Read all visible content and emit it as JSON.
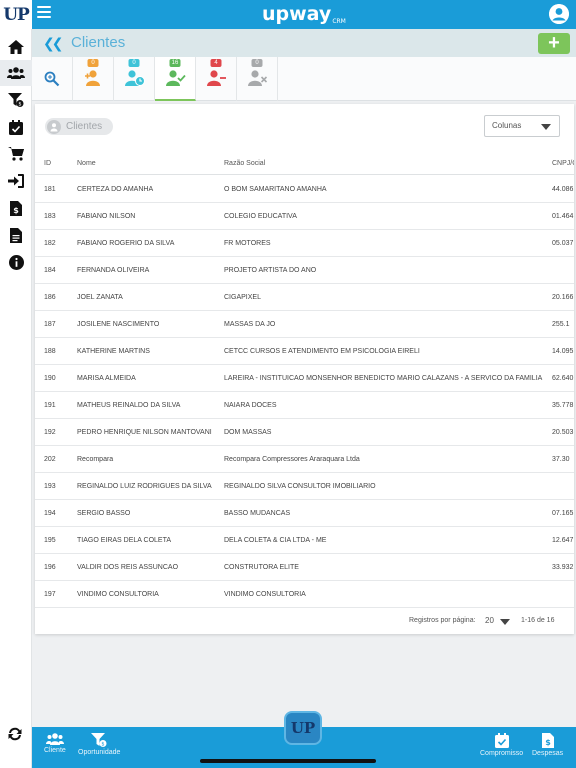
{
  "app": {
    "logo_text": "UP",
    "brand": "upway",
    "brand_suffix": "CRM",
    "center_logo_text": "UP"
  },
  "header": {
    "title": "Clientes",
    "add_label": "+"
  },
  "tabs": [
    {
      "badge": "0",
      "badge_color": "#f0a23a",
      "icon": "add-user-icon",
      "icon_color": "#f0a23a"
    },
    {
      "badge": "0",
      "badge_color": "#3ec3d8",
      "icon": "user-clock-icon",
      "icon_color": "#3ec3d8"
    },
    {
      "badge": "16",
      "badge_color": "#5cb85c",
      "icon": "user-check-icon",
      "icon_color": "#5cb85c"
    },
    {
      "badge": "4",
      "badge_color": "#e0474c",
      "icon": "remove-user-icon",
      "icon_color": "#e0474c"
    },
    {
      "badge": "0",
      "badge_color": "#a7a9ab",
      "icon": "user-x-icon",
      "icon_color": "#a7a9ab"
    }
  ],
  "filter_chip": "Clientes",
  "columns_select": "Colunas",
  "table": {
    "headers": {
      "id": "ID",
      "nome": "Nome",
      "razao": "Razão Social",
      "cnpj": "CNPJ/C"
    },
    "rows": [
      {
        "id": "181",
        "nome": "CERTEZA DO AMANHA",
        "razao": "O BOM SAMARITANO AMANHA",
        "cnpj": "44.086"
      },
      {
        "id": "183",
        "nome": "FABIANO NILSON",
        "razao": "COLEGIO EDUCATIVA",
        "cnpj": "01.464"
      },
      {
        "id": "182",
        "nome": "FABIANO ROGERIO DA SILVA",
        "razao": "FR MOTORES",
        "cnpj": "05.037"
      },
      {
        "id": "184",
        "nome": "FERNANDA OLIVEIRA",
        "razao": "PROJETO ARTISTA DO ANO",
        "cnpj": ""
      },
      {
        "id": "186",
        "nome": "JOEL ZANATA",
        "razao": "CIGAPIXEL",
        "cnpj": "20.166"
      },
      {
        "id": "187",
        "nome": "JOSILENE NASCIMENTO",
        "razao": "MASSAS DA JO",
        "cnpj": "255.1"
      },
      {
        "id": "188",
        "nome": "KATHERINE MARTINS",
        "razao": "CETCC CURSOS E ATENDIMENTO EM PSICOLOGIA EIRELI",
        "cnpj": "14.095"
      },
      {
        "id": "190",
        "nome": "MARISA ALMEIDA",
        "razao": "LAREIRA - INSTITUICAO MONSENHOR BENEDICTO MARIO CALAZANS - A SERVICO DA FAMILIA",
        "cnpj": "62.640"
      },
      {
        "id": "191",
        "nome": "MATHEUS REINALDO DA SILVA",
        "razao": "NAIARA DOCES",
        "cnpj": "35.778"
      },
      {
        "id": "192",
        "nome": "PEDRO HENRIQUE NILSON MANTOVANI",
        "razao": "DOM MASSAS",
        "cnpj": "20.503"
      },
      {
        "id": "202",
        "nome": "Recompara",
        "razao": "Recompara Compressores Araraquara Ltda",
        "cnpj": "37.30"
      },
      {
        "id": "193",
        "nome": "REGINALDO LUIZ RODRIGUES DA SILVA",
        "razao": "REGINALDO SILVA CONSULTOR IMOBILIARIO",
        "cnpj": ""
      },
      {
        "id": "194",
        "nome": "SERGIO BASSO",
        "razao": "BASSO MUDANCAS",
        "cnpj": "07.165"
      },
      {
        "id": "195",
        "nome": "TIAGO EIRAS DELA COLETA",
        "razao": "DELA COLETA & CIA LTDA - ME",
        "cnpj": "12.647"
      },
      {
        "id": "196",
        "nome": "VALDIR DOS REIS ASSUNCAO",
        "razao": "CONSTRUTORA ELITE",
        "cnpj": "33.932"
      },
      {
        "id": "197",
        "nome": "VINDIMO CONSULTORIA",
        "razao": "VINDIMO CONSULTORIA",
        "cnpj": ""
      }
    ]
  },
  "pagination": {
    "label": "Registros por página:",
    "per_page": "20",
    "range": "1-16 de 16"
  },
  "bottom_nav": {
    "cliente": "Cliente",
    "oportunidade": "Oportunidade",
    "compromisso": "Compromisso",
    "despesas": "Despesas"
  },
  "colors": {
    "primary": "#1a9cd8",
    "accent_green": "#7dc55b",
    "title_bar": "#dbe7ea"
  }
}
